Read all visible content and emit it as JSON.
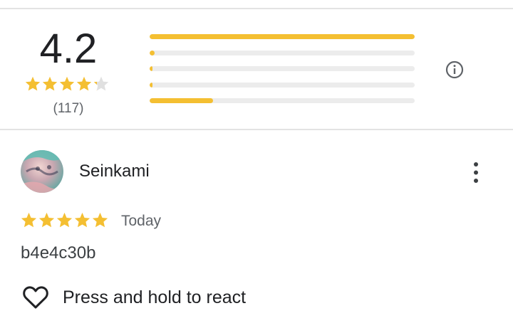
{
  "summary": {
    "average": "4.2",
    "stars": 4.2,
    "count": "(117)",
    "distribution": [
      1.0,
      0.02,
      0.01,
      0.01,
      0.24
    ]
  },
  "review": {
    "author": "Seinkami",
    "stars": 5,
    "date": "Today",
    "text": "b4e4c30b"
  },
  "actions": {
    "react_label": "Press and hold to react"
  },
  "icons": {
    "info": "info-icon",
    "more": "more-vert-icon",
    "heart": "heart-outline-icon"
  },
  "colors": {
    "star": "#f4bf32",
    "star_empty": "#e0e0e0",
    "bar_fill": "#f4bf32",
    "bar_track": "#ececec"
  }
}
